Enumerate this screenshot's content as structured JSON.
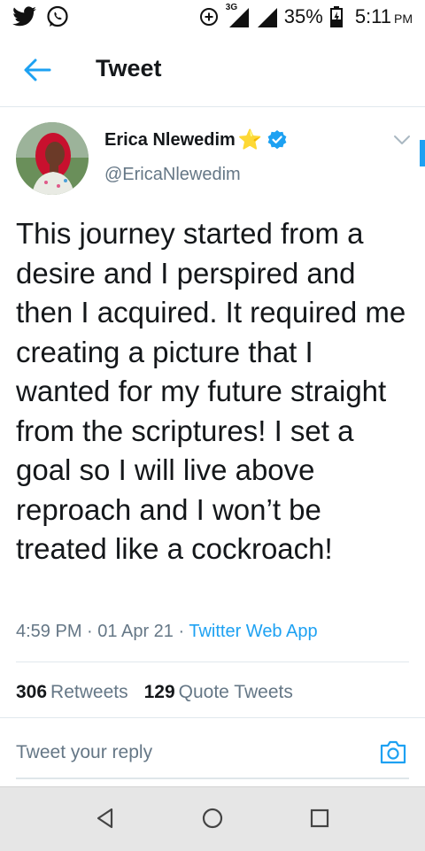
{
  "status_bar": {
    "left_icons": [
      "twitter-icon",
      "whatsapp-icon"
    ],
    "right_icons": [
      "data-saver-icon",
      "signal-icon",
      "signal-icon-2",
      "battery-icon"
    ],
    "network": "3G",
    "battery": "35%",
    "time": "5:11",
    "ampm": "PM"
  },
  "app_bar": {
    "title": "Tweet",
    "back_icon": "arrow-left-icon"
  },
  "tweet": {
    "author_name": "Erica Nlewedim",
    "author_emoji": "⭐",
    "verified_icon": "verified-badge-icon",
    "handle": "@EricaNlewedim",
    "text": "This journey started from a desire and I perspired and then I acquired. It required me creating a picture that I wanted for my future straight from the scriptures! I set a goal so I will live above reproach and I won’t be treated like a cockroach!",
    "time": "4:59 PM",
    "sep": "·",
    "date": "01 Apr 21",
    "source": "Twitter Web App",
    "retweets_count": "306",
    "retweets_label": "Retweets",
    "quotes_count": "129",
    "quotes_label": "Quote Tweets"
  },
  "reply": {
    "placeholder": "Tweet your reply",
    "camera_icon": "camera-icon"
  },
  "nav_bar": {
    "icons": [
      "back-triangle-icon",
      "home-circle-icon",
      "recents-square-icon"
    ]
  },
  "colors": {
    "accent": "#1da1f2",
    "text": "#14171a",
    "secondary": "#657786",
    "divider": "#e1e8ed",
    "nav_bg": "#e6e6e6"
  }
}
